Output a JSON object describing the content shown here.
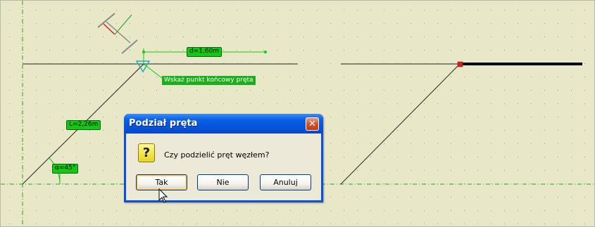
{
  "canvas": {
    "background": "#e8e7c8",
    "grid_dot_color": "#9a9a9a",
    "guide_color": "#1fae1f",
    "annotation_color": "#13c813"
  },
  "annotations": {
    "dimension_label": "d=1,60m",
    "length_label": "L=2,26m",
    "angle_label": "α=45°",
    "hint_text": "Wskaż punkt końcowy pręta"
  },
  "dialog": {
    "title": "Podział pręta",
    "icon": "question-icon",
    "message": "Czy podzielić pręt węzłem?",
    "buttons": {
      "yes": "Tak",
      "no": "Nie",
      "cancel": "Anuluj"
    },
    "close_glyph": "✕",
    "default_button": "yes"
  }
}
